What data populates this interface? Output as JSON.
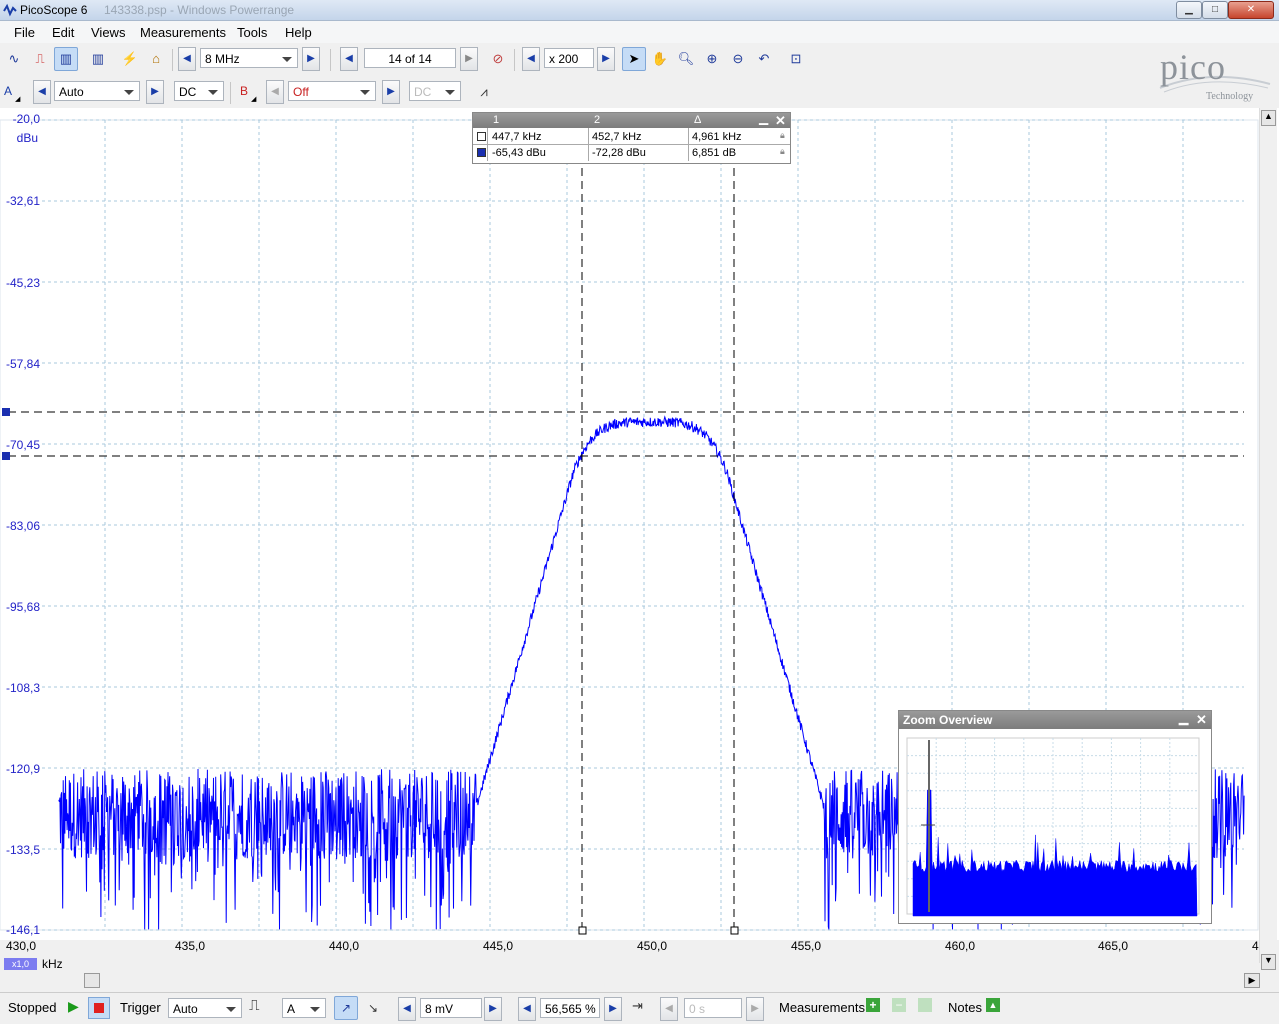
{
  "window": {
    "title": "PicoScope 6",
    "subtitle": "143338.psp - Windows Powerrange",
    "minimize": "▁",
    "maximize": "□",
    "close": "✕"
  },
  "menu": [
    {
      "label": "File"
    },
    {
      "label": "Edit"
    },
    {
      "label": "Views"
    },
    {
      "label": "Measurements"
    },
    {
      "label": "Tools"
    },
    {
      "label": "Help"
    }
  ],
  "toolbar1": {
    "frequency": "8 MHz",
    "buffer": "14 of 14",
    "zoom": "x 200"
  },
  "toolbar2": {
    "channel_a_label": "A",
    "channel_a_range": "Auto",
    "channel_a_coupling": "DC",
    "channel_b_label": "B",
    "channel_b_range": "Off",
    "channel_b_coupling": "DC"
  },
  "brand": {
    "logo": "pico",
    "tagline": "Technology"
  },
  "plot": {
    "y_unit": "dBu",
    "x_unit": "kHz",
    "x_scale_badge": "x1,0",
    "y_ticks": [
      "-20,0",
      "-32,61",
      "-45,23",
      "-57,84",
      "-70,45",
      "-83,06",
      "-95,68",
      "-108,3",
      "-120,9",
      "-133,5",
      "-146,1"
    ],
    "x_ticks": [
      "430,0",
      "435,0",
      "440,0",
      "445,0",
      "450,0",
      "455,0",
      "460,0",
      "465,0",
      "4"
    ],
    "y_range": [
      -146.1,
      -20.0
    ],
    "x_range": [
      430.0,
      470.0
    ],
    "trace_color": "#0000ff",
    "cursor_color": "#000000",
    "grid_color": "#a8c8dc"
  },
  "cursor_table": {
    "headers": [
      "1",
      "2",
      "Δ"
    ],
    "rows": [
      {
        "c1": "447,7 kHz",
        "c2": "452,7 kHz",
        "delta": "4,961 kHz"
      },
      {
        "c1": "-65,43 dBu",
        "c2": "-72,28 dBu",
        "delta": "6,851 dB"
      }
    ]
  },
  "zoom_overview": {
    "title": "Zoom Overview"
  },
  "statusbar": {
    "state": "Stopped",
    "trigger_label": "Trigger",
    "trigger_mode": "Auto",
    "trigger_channel": "A",
    "threshold": "8 mV",
    "pretrigger": "56,565 %",
    "delay": "0 s",
    "measurements_label": "Measurements",
    "notes_label": "Notes"
  }
}
